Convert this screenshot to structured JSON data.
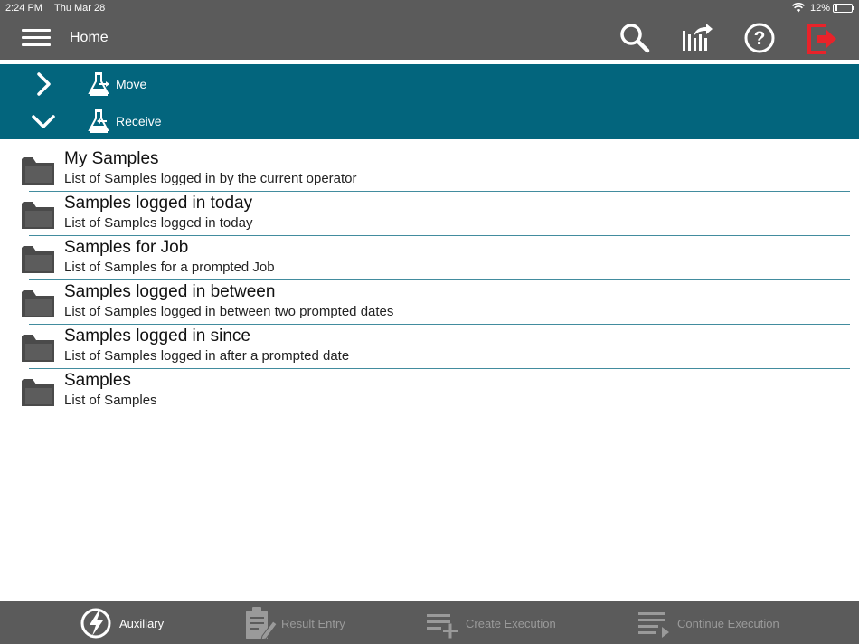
{
  "status_bar": {
    "time": "2:24 PM",
    "date": "Thu Mar 28",
    "battery": "12%",
    "wifi_icon": "wifi-icon"
  },
  "header": {
    "title": "Home",
    "icons": [
      "menu-icon",
      "search-icon",
      "report-export-icon",
      "help-icon",
      "logout-icon"
    ]
  },
  "actions": [
    {
      "label": "Move",
      "chevron": "chevron-right-icon",
      "icon": "flask-move-icon"
    },
    {
      "label": "Receive",
      "chevron": "chevron-down-icon",
      "icon": "flask-receive-icon"
    }
  ],
  "list": [
    {
      "title": "My Samples",
      "description": "List of Samples logged in by the current operator"
    },
    {
      "title": "Samples logged in today",
      "description": "List of Samples logged in today"
    },
    {
      "title": "Samples for Job",
      "description": "List of Samples for a prompted Job"
    },
    {
      "title": "Samples logged in between",
      "description": "List of Samples logged in between two prompted dates"
    },
    {
      "title": "Samples logged in since",
      "description": "List of Samples logged in after a prompted date"
    },
    {
      "title": "Samples",
      "description": "List of Samples"
    }
  ],
  "bottom_tabs": [
    {
      "label": "Auxiliary",
      "icon": "lightning-icon",
      "active": true
    },
    {
      "label": "Result Entry",
      "icon": "clipboard-edit-icon",
      "active": false
    },
    {
      "label": "Create Execution",
      "icon": "list-add-icon",
      "active": false
    },
    {
      "label": "Continue Execution",
      "icon": "list-play-icon",
      "active": false
    }
  ],
  "colors": {
    "header_bg": "#5b5b5b",
    "accent": "#03657d",
    "logout": "#e8232a",
    "folder": "#4a4a4a"
  }
}
